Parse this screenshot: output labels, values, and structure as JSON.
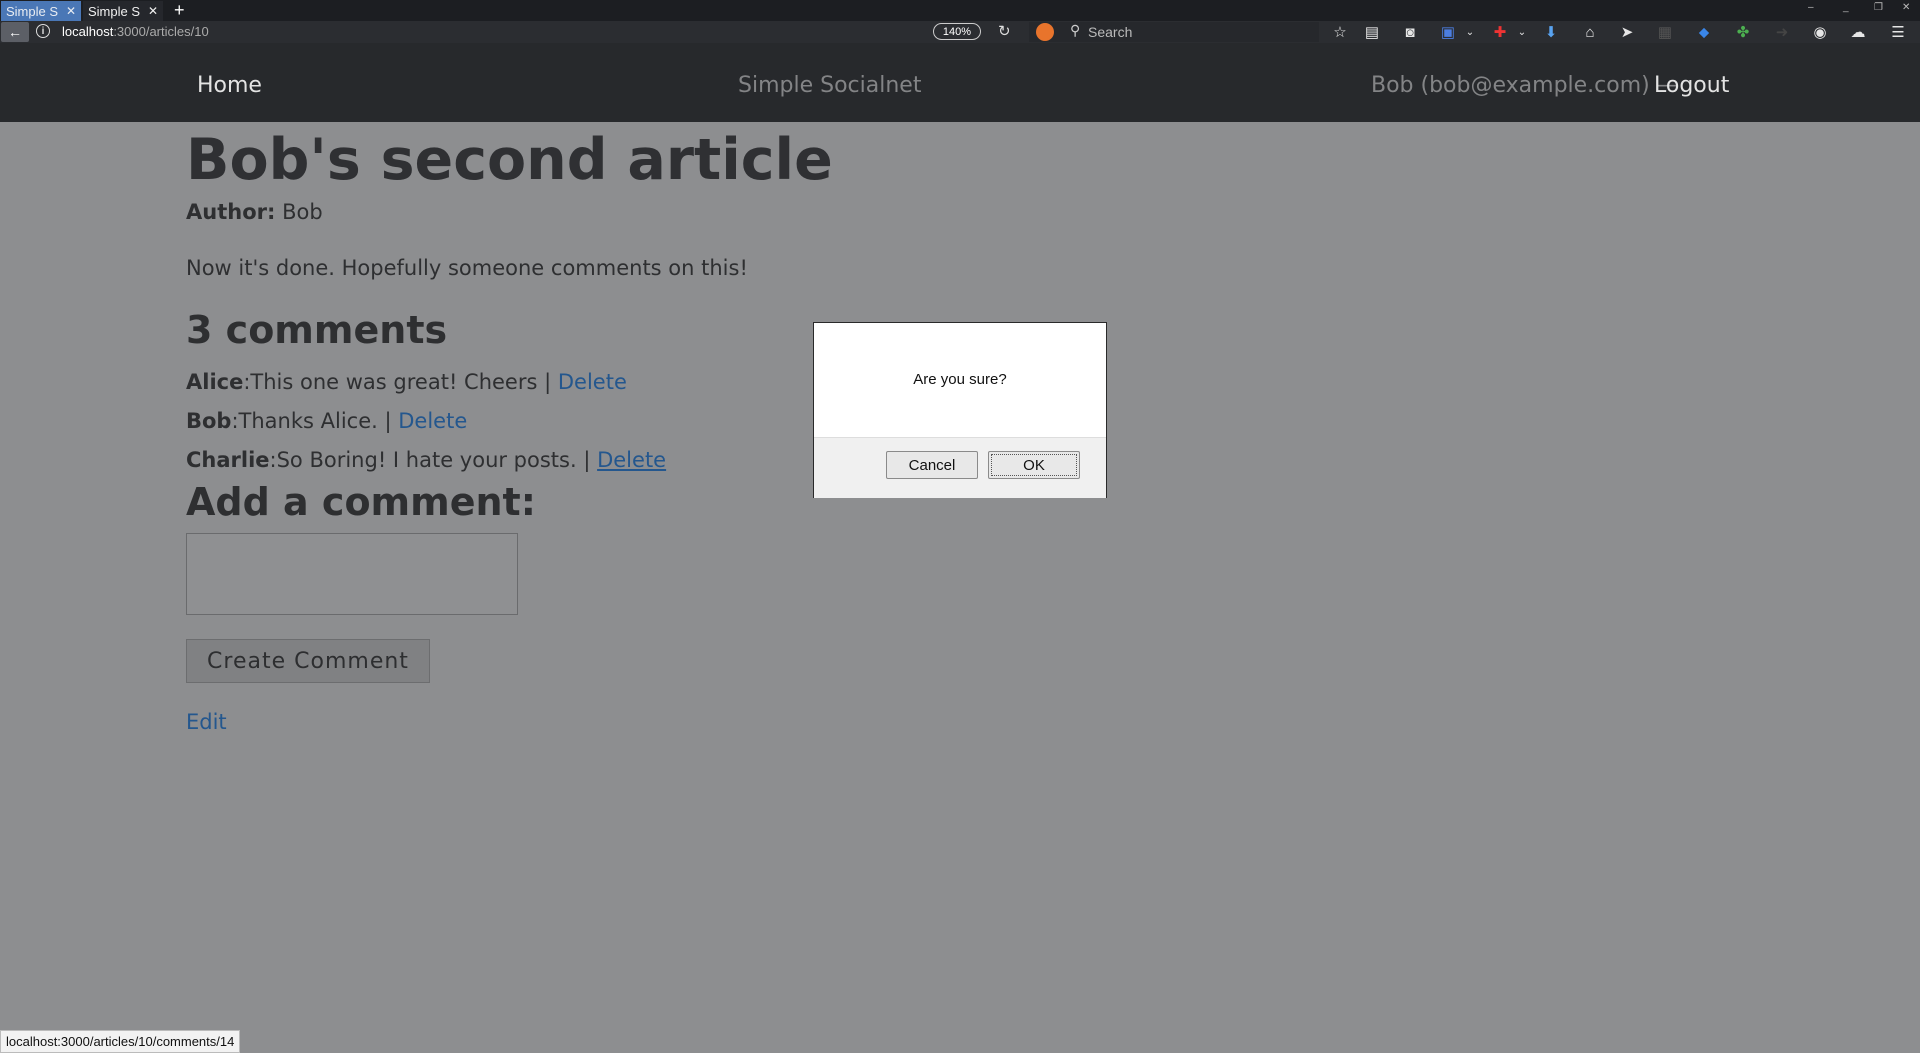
{
  "browser": {
    "tabs": [
      {
        "label": "Simple S",
        "active": true
      },
      {
        "label": "Simple S",
        "active": false
      }
    ],
    "url": {
      "host": "localhost",
      "path": ":3000/articles/10"
    },
    "zoom": "140%",
    "search_placeholder": "Search",
    "status_url": "localhost:3000/articles/10/comments/14"
  },
  "site_nav": {
    "home": "Home",
    "brand": "Simple Socialnet",
    "user": "Bob (bob@example.com) —",
    "logout": "Logout"
  },
  "article": {
    "title": "Bob's second article",
    "author_label": "Author:",
    "author": "Bob",
    "body": "Now it's done. Hopefully someone comments on this!"
  },
  "comments": {
    "heading": "3 comments",
    "delete_label": "Delete",
    "items": [
      {
        "author": "Alice",
        "text": ":This one was great! Cheers | "
      },
      {
        "author": "Bob",
        "text": ":Thanks Alice. | "
      },
      {
        "author": "Charlie",
        "text": ":So Boring! I hate your posts. | "
      }
    ]
  },
  "form": {
    "heading": "Add a comment:",
    "textarea_value": "",
    "submit_label": "Create Comment"
  },
  "edit_link": "Edit",
  "dialog": {
    "message": "Are you sure?",
    "cancel": "Cancel",
    "ok": "OK"
  },
  "colors": {
    "overlay_bg": "#8d8e90",
    "nav_bg": "#27292c",
    "link": "#24578e"
  }
}
